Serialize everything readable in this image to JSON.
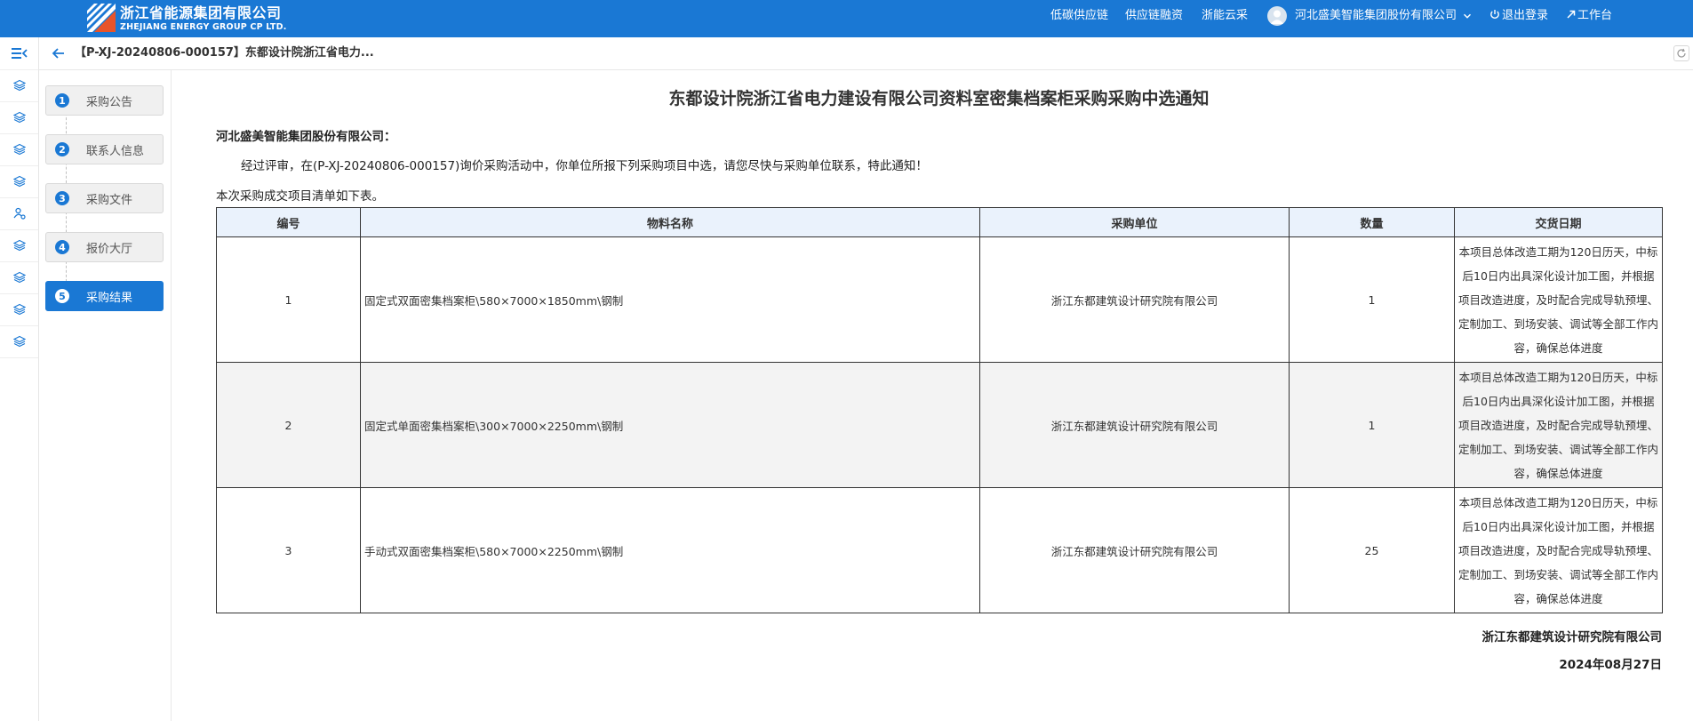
{
  "brand": {
    "name_cn": "浙江省能源集团有限公司",
    "name_en": "ZHEJIANG ENERGY GROUP CP LTD."
  },
  "topnav": {
    "items": [
      {
        "label": "低碳供应链"
      },
      {
        "label": "供应链融资"
      },
      {
        "label": "浙能云采"
      }
    ],
    "company": "河北盛美智能集团股份有限公司",
    "logout": "退出登录",
    "workbench": "工作台"
  },
  "header": {
    "title": "【P-XJ-20240806-000157】东都设计院浙江省电力..."
  },
  "steps": [
    {
      "num": "1",
      "label": "采购公告",
      "active": false
    },
    {
      "num": "2",
      "label": "联系人信息",
      "active": false
    },
    {
      "num": "3",
      "label": "采购文件",
      "active": false
    },
    {
      "num": "4",
      "label": "报价大厅",
      "active": false
    },
    {
      "num": "5",
      "label": "采购结果",
      "active": true
    }
  ],
  "notice": {
    "title": "东都设计院浙江省电力建设有限公司资料室密集档案柜采购采购中选通知",
    "recipient": "河北盛美智能集团股份有限公司：",
    "body": "经过评审，在(P-XJ-20240806-000157)询价采购活动中，你单位所报下列采购项目中选，请您尽快与采购单位联系，特此通知！",
    "intro": "本次采购成交项目清单如下表。",
    "columns": [
      "编号",
      "物料名称",
      "采购单位",
      "数量",
      "交货日期"
    ],
    "rows": [
      {
        "no": "1",
        "material": "固定式双面密集档案柜\\580×7000×1850mm\\钢制",
        "unit": "浙江东都建筑设计研究院有限公司",
        "qty": "1",
        "delivery": "本项目总体改造工期为120日历天，中标后10日内出具深化设计加工图，并根据项目改造进度，及时配合完成导轨预埋、定制加工、到场安装、调试等全部工作内容，确保总体进度"
      },
      {
        "no": "2",
        "material": "固定式单面密集档案柜\\300×7000×2250mm\\钢制",
        "unit": "浙江东都建筑设计研究院有限公司",
        "qty": "1",
        "delivery": "本项目总体改造工期为120日历天，中标后10日内出具深化设计加工图，并根据项目改造进度，及时配合完成导轨预埋、定制加工、到场安装、调试等全部工作内容，确保总体进度"
      },
      {
        "no": "3",
        "material": "手动式双面密集档案柜\\580×7000×2250mm\\钢制",
        "unit": "浙江东都建筑设计研究院有限公司",
        "qty": "25",
        "delivery": "本项目总体改造工期为120日历天，中标后10日内出具深化设计加工图，并根据项目改造进度，及时配合完成导轨预埋、定制加工、到场安装、调试等全部工作内容，确保总体进度"
      }
    ],
    "signatory": "浙江东都建筑设计研究院有限公司",
    "date": "2024年08月27日"
  },
  "colors": {
    "brand_blue": "#1a78d4",
    "header_cell": "#eaf2fc",
    "logo_red": "#e8542a"
  },
  "icons": {
    "rail": [
      "menu-collapse-icon",
      "layers-icon",
      "layers-icon",
      "layers-icon",
      "layers-icon",
      "user-settings-icon",
      "layers-icon",
      "layers-icon",
      "layers-icon",
      "layers-icon"
    ]
  }
}
